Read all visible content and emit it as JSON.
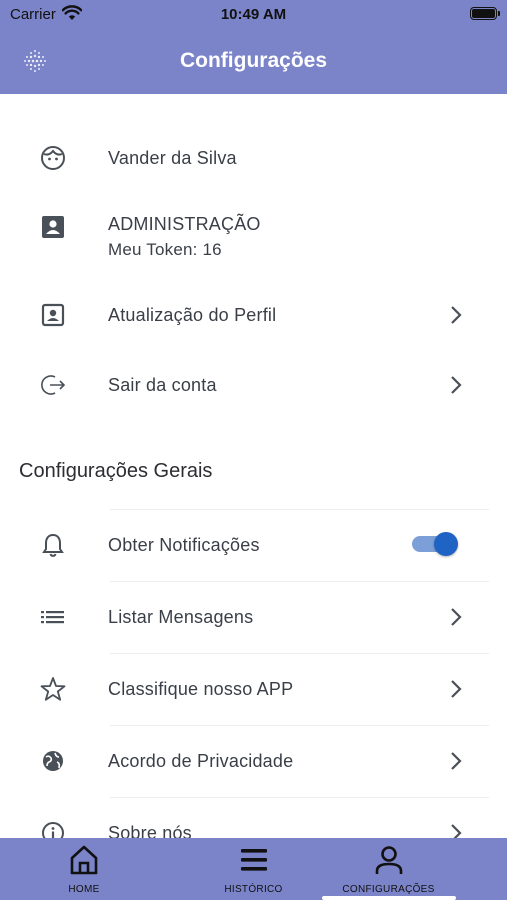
{
  "status_bar": {
    "carrier": "Carrier",
    "time": "10:49 AM"
  },
  "header": {
    "title": "Configurações"
  },
  "profile": {
    "name": "Vander da Silva",
    "role": "ADMINISTRAÇÃO",
    "token": "Meu Token: 16",
    "update_profile": "Atualização do Perfil",
    "logout": "Sair da conta"
  },
  "general": {
    "title": "Configurações Gerais",
    "notifications": {
      "label": "Obter Notificações",
      "enabled": true
    },
    "messages": "Listar Mensagens",
    "rate": "Classifique nosso APP",
    "privacy": "Acordo de Privacidade",
    "about": "Sobre nós"
  },
  "tabs": [
    {
      "label": "HOME",
      "icon": "home-icon"
    },
    {
      "label": "HISTÓRICO",
      "icon": "menu-icon"
    },
    {
      "label": "CONFIGURAÇÕES",
      "icon": "user-icon"
    }
  ],
  "colors": {
    "header": "#7b84c9",
    "toggle_on": "#1f63c5",
    "toggle_track": "#7b9fd6"
  }
}
